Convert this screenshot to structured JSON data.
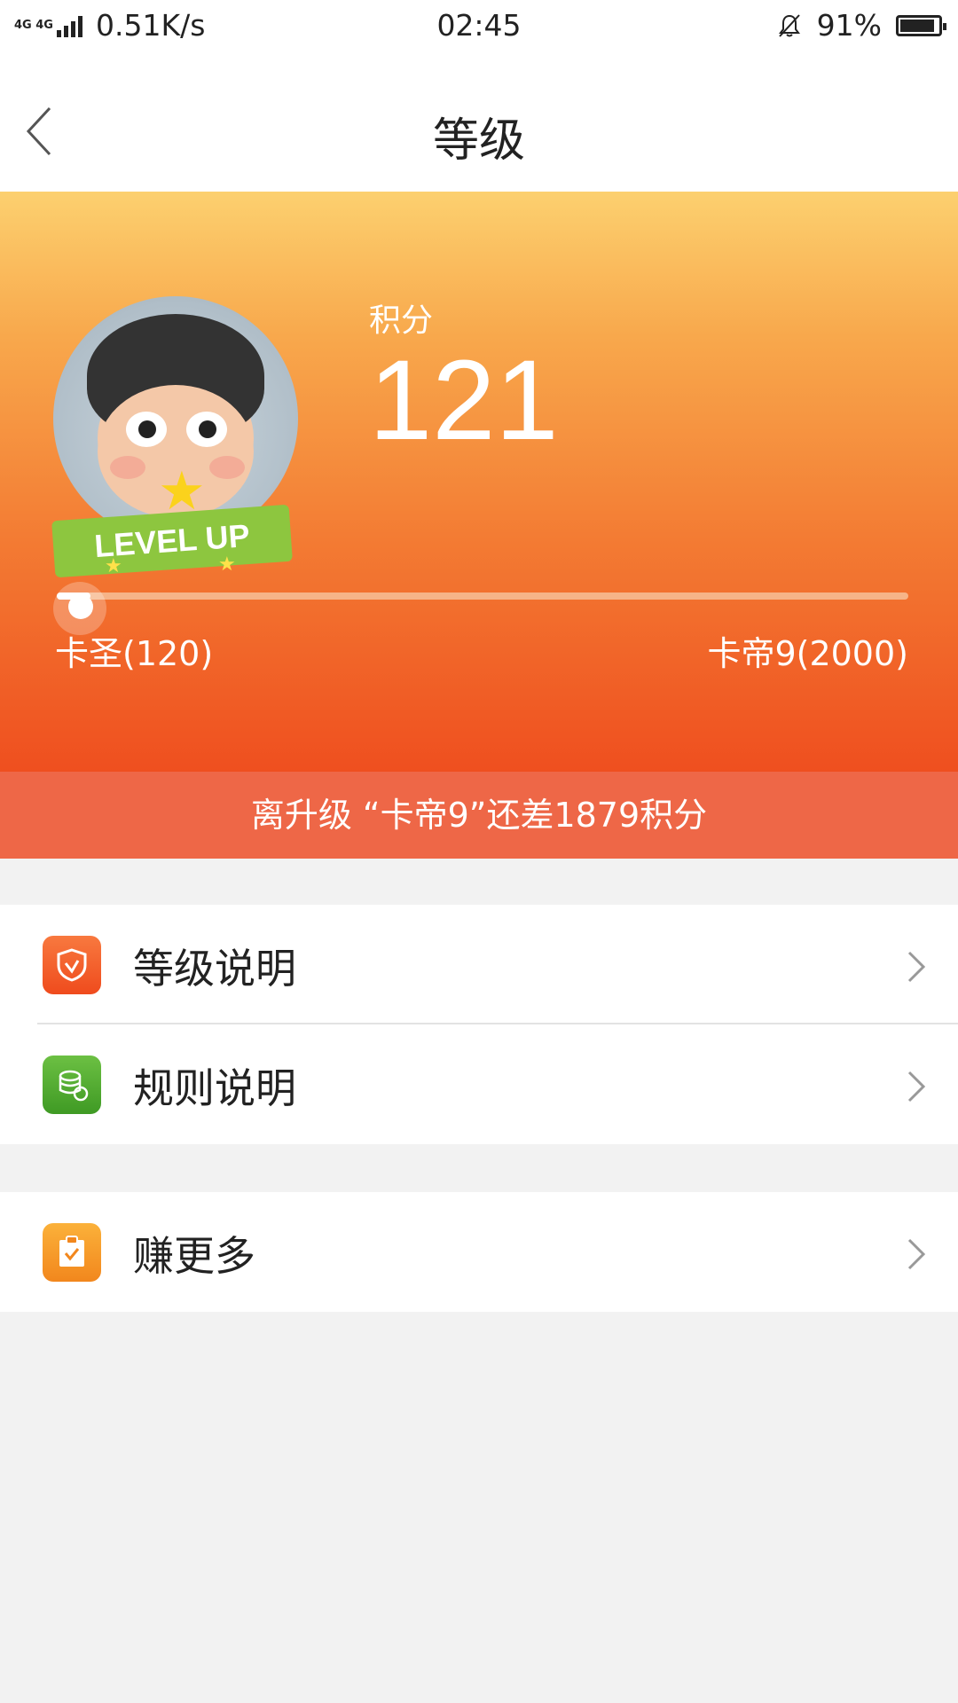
{
  "status_bar": {
    "network_type": "4G 4G",
    "speed": "0.51K/s",
    "time": "02:45",
    "battery": "91%",
    "battery_level": 0.91
  },
  "header": {
    "title": "等级"
  },
  "hero": {
    "badge_text": "LEVEL UP",
    "score_label": "积分",
    "score_value": "121",
    "current_level": "卡圣(120)",
    "next_level": "卡帝9(2000)",
    "progress": 0.04,
    "notice": "离升级 “卡帝9”还差1879积分"
  },
  "menu": [
    {
      "label": "等级说明",
      "icon": "shield-check-icon",
      "color": "#f35a2a"
    },
    {
      "label": "规则说明",
      "icon": "coins-icon",
      "color": "#4ca82e"
    },
    {
      "label": "赚更多",
      "icon": "clipboard-check-icon",
      "color": "#f59a22"
    }
  ],
  "colors": {
    "hero_top": "#fcd06f",
    "hero_bottom": "#ef4f1f",
    "notice_bar": "#ee6747",
    "background": "#f2f2f2"
  }
}
